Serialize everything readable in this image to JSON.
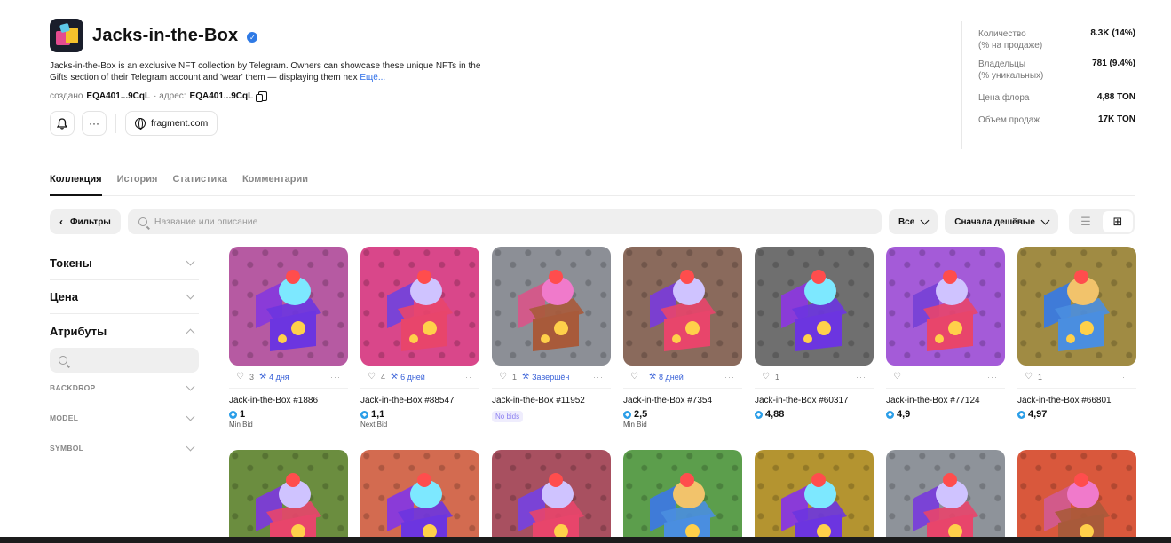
{
  "collection": {
    "title": "Jacks-in-the-Box",
    "description": "Jacks-in-the-Box is an exclusive NFT collection by Telegram. Owners can showcase these unique NFTs in the Gifts section of their Telegram account and 'wear' them — displaying them nex",
    "more_label": "Ещё...",
    "created_label": "создано",
    "creator": "EQA401...9CqL",
    "address_label": "· адрес:",
    "address": "EQA401...9CqL",
    "link": "fragment.com"
  },
  "stats": [
    {
      "label": "Количество",
      "sub": "(% на продаже)",
      "value": "8.3K (14%)"
    },
    {
      "label": "Владельцы",
      "sub": "(% уникальных)",
      "value": "781 (9.4%)"
    },
    {
      "label": "Цена флора",
      "sub": "",
      "value": "4,88 TON"
    },
    {
      "label": "Объем продаж",
      "sub": "",
      "value": "17K TON"
    }
  ],
  "tabs": [
    "Коллекция",
    "История",
    "Статистика",
    "Комментарии"
  ],
  "toolbar": {
    "filters_label": "Фильтры",
    "search_placeholder": "Название или описание",
    "status_filter": "Все",
    "sort": "Сначала дешёвые"
  },
  "sidebar": {
    "sections": [
      "Токены",
      "Цена",
      "Атрибуты"
    ],
    "attributes": [
      "BACKDROP",
      "MODEL",
      "SYMBOL"
    ]
  },
  "items": [
    {
      "likes": "3",
      "status": "4 дня",
      "name": "Jack-in-the-Box #1886",
      "price": "1",
      "price_label": "Min Bid",
      "bg": "#b65aa2"
    },
    {
      "likes": "4",
      "status": "6 дней",
      "name": "Jack-in-the-Box #88547",
      "price": "1,1",
      "price_label": "Next Bid",
      "bg": "#d9478a"
    },
    {
      "likes": "1",
      "status": "Завершён",
      "name": "Jack-in-the-Box #11952",
      "price": "",
      "price_label": "No bids",
      "bg": "#8c8f96"
    },
    {
      "likes": "",
      "status": "8 дней",
      "name": "Jack-in-the-Box #7354",
      "price": "2,5",
      "price_label": "Min Bid",
      "bg": "#8a6a5c"
    },
    {
      "likes": "1",
      "status": "",
      "name": "Jack-in-the-Box #60317",
      "price": "4,88",
      "price_label": "",
      "bg": "#6f6f6f"
    },
    {
      "likes": "",
      "status": "",
      "name": "Jack-in-the-Box #77124",
      "price": "4,9",
      "price_label": "",
      "bg": "#a45bd8"
    },
    {
      "likes": "1",
      "status": "",
      "name": "Jack-in-the-Box #66801",
      "price": "4,97",
      "price_label": "",
      "bg": "#a08b43"
    }
  ],
  "row2_colors": [
    "#6b8d3f",
    "#d36b50",
    "#a85060",
    "#5c9e4c",
    "#b49430",
    "#8e939a",
    "#d9583c"
  ],
  "colors": {
    "accent": "#2f6fe8",
    "ton": "#2a9ee8",
    "nobids_text": "#8b7ff0"
  }
}
